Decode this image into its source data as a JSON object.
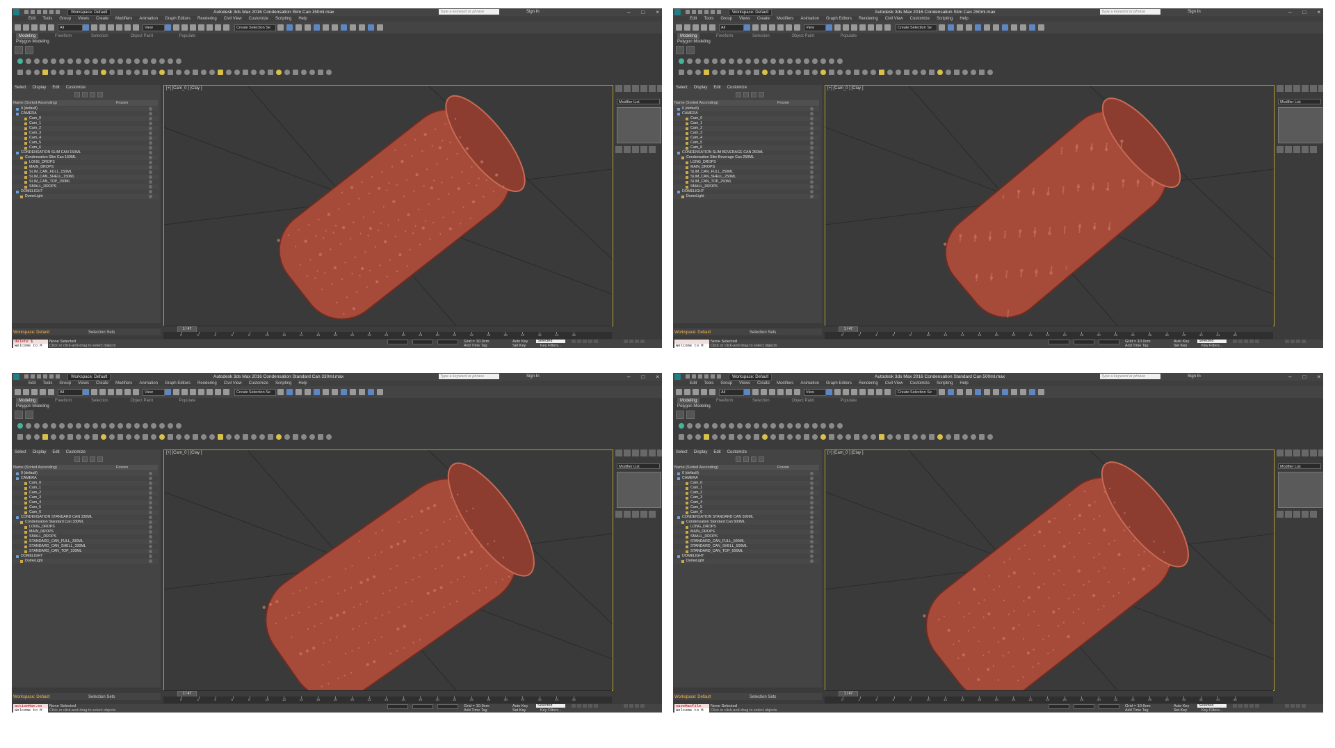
{
  "panels": [
    {
      "title": "Autodesk 3ds Max 2016     Condensation Slim Can 150ml.max",
      "workspace": "Workspace: Default",
      "search_placeholder": "Type a keyword or phrase",
      "sign_in": "Sign In",
      "menu": [
        "Edit",
        "Tools",
        "Group",
        "Views",
        "Create",
        "Modifiers",
        "Animation",
        "Graph Editors",
        "Rendering",
        "Civil View",
        "Customize",
        "Scripting",
        "Help"
      ],
      "ribbon_tabs": [
        "Modeling",
        "Freeform",
        "Selection",
        "Object Paint",
        "Populate"
      ],
      "ribbon_sub": "Polygon Modeling",
      "dropdown_all": "All",
      "dropdown_view": "View",
      "dropdown_sel": "Create Selection Se",
      "se_tabs": [
        "Select",
        "Display",
        "Edit",
        "Customize"
      ],
      "se_col_name": "Name (Sorted Ascending)",
      "se_col_frozen": "Frozen",
      "tree": [
        {
          "label": "0 (default)",
          "indent": 1
        },
        {
          "label": "CAMERA",
          "indent": 1
        },
        {
          "label": "Cam_0",
          "indent": 3
        },
        {
          "label": "Cam_1",
          "indent": 3
        },
        {
          "label": "Cam_2",
          "indent": 3
        },
        {
          "label": "Cam_3",
          "indent": 3
        },
        {
          "label": "Cam_4",
          "indent": 3
        },
        {
          "label": "Cam_5",
          "indent": 3
        },
        {
          "label": "Cam_6",
          "indent": 3
        },
        {
          "label": "CONDENSATION SLIM CAN 150ML",
          "indent": 1
        },
        {
          "label": "Condensation Slim Can 150ML",
          "indent": 2
        },
        {
          "label": "LONG_DROPS",
          "indent": 3
        },
        {
          "label": "MAIN_DROPS",
          "indent": 3
        },
        {
          "label": "SLIM_CAN_FULL_150ML",
          "indent": 3
        },
        {
          "label": "SLIM_CAN_SHELL_150ML",
          "indent": 3
        },
        {
          "label": "SLIM_CAN_TOP_150ML",
          "indent": 3
        },
        {
          "label": "SMALL_DROPS",
          "indent": 3
        },
        {
          "label": "DOMELIGHT",
          "indent": 1
        },
        {
          "label": "DomeLight",
          "indent": 2
        }
      ],
      "ws_name": "Workspace: Default",
      "selection_sets": "Selection Sets",
      "viewport_label": "[+] [Cam_0 ] [Clay ]",
      "modifier_list": "Modifier List",
      "frame": "1 / 47",
      "ticks": [
        "0",
        "2",
        "4",
        "6",
        "8",
        "10",
        "12",
        "14",
        "16",
        "18",
        "20",
        "22",
        "24",
        "26",
        "28",
        "30",
        "32",
        "34",
        "36",
        "38",
        "40",
        "42",
        "44",
        "46"
      ],
      "maxscript": "delete $",
      "welcome": "Welcome to M",
      "none_selected": "None Selected",
      "hint": "Click or click-and-drag to select objects",
      "grid": "Grid = 10.0cm",
      "add_time_tag": "Add Time Tag",
      "auto_key": "Auto Key",
      "set_key": "Set Key",
      "selected": "Selected",
      "key_filters": "Key Filters..."
    },
    {
      "title": "Autodesk 3ds Max 2016     Condensation Slim Can 250ml.max",
      "workspace": "Workspace: Default",
      "search_placeholder": "Type a keyword or phrase",
      "sign_in": "Sign In",
      "menu": [
        "Edit",
        "Tools",
        "Group",
        "Views",
        "Create",
        "Modifiers",
        "Animation",
        "Graph Editors",
        "Rendering",
        "Civil View",
        "Customize",
        "Scripting",
        "Help"
      ],
      "ribbon_tabs": [
        "Modeling",
        "Freeform",
        "Selection",
        "Object Paint",
        "Populate"
      ],
      "ribbon_sub": "Polygon Modeling",
      "dropdown_all": "All",
      "dropdown_view": "View",
      "dropdown_sel": "Create Selection Se",
      "se_tabs": [
        "Select",
        "Display",
        "Edit",
        "Customize"
      ],
      "se_col_name": "Name (Sorted Ascending)",
      "se_col_frozen": "Frozen",
      "tree": [
        {
          "label": "0 (default)",
          "indent": 1
        },
        {
          "label": "CAMERA",
          "indent": 1
        },
        {
          "label": "Cam_0",
          "indent": 3
        },
        {
          "label": "Cam_1",
          "indent": 3
        },
        {
          "label": "Cam_2",
          "indent": 3
        },
        {
          "label": "Cam_3",
          "indent": 3
        },
        {
          "label": "Cam_4",
          "indent": 3
        },
        {
          "label": "Cam_5",
          "indent": 3
        },
        {
          "label": "Cam_6",
          "indent": 3
        },
        {
          "label": "CONDENSATION SLIM BEVERAGE CAN 250ML",
          "indent": 1
        },
        {
          "label": "Condensation Slim Beverage Can 250ML",
          "indent": 2
        },
        {
          "label": "LONG_DROPS",
          "indent": 3
        },
        {
          "label": "MAIN_DROPS",
          "indent": 3
        },
        {
          "label": "SLIM_CAN_FULL_250ML",
          "indent": 3
        },
        {
          "label": "SLIM_CAN_SHELL_250ML",
          "indent": 3
        },
        {
          "label": "SLIM_CAN_TOP_250ML",
          "indent": 3
        },
        {
          "label": "SMALL_DROPS",
          "indent": 3
        },
        {
          "label": "DOMELIGHT",
          "indent": 1
        },
        {
          "label": "DomeLight",
          "indent": 2
        }
      ],
      "ws_name": "Workspace: Default",
      "selection_sets": "Selection Sets",
      "viewport_label": "[+] [Cam_0 ] [Clay ]",
      "modifier_list": "Modifier List",
      "frame": "1 / 47",
      "ticks": [
        "0",
        "2",
        "4",
        "6",
        "8",
        "10",
        "12",
        "14",
        "16",
        "18",
        "20",
        "22",
        "24",
        "26",
        "28",
        "30",
        "32",
        "34",
        "36",
        "38",
        "40",
        "42",
        "44",
        "46"
      ],
      "maxscript": "",
      "welcome": "Welcome to M",
      "none_selected": "None Selected",
      "hint": "Click or click-and-drag to select objects",
      "grid": "Grid = 10.0cm",
      "add_time_tag": "Add Time Tag",
      "auto_key": "Auto Key",
      "set_key": "Set Key",
      "selected": "Selected",
      "key_filters": "Key Filters..."
    },
    {
      "title": "Autodesk 3ds Max 2016     Condensation Standard Can 330ml.max",
      "workspace": "Workspace: Default",
      "search_placeholder": "Type a keyword or phrase",
      "sign_in": "Sign In",
      "menu": [
        "Edit",
        "Tools",
        "Group",
        "Views",
        "Create",
        "Modifiers",
        "Animation",
        "Graph Editors",
        "Rendering",
        "Civil View",
        "Customize",
        "Scripting",
        "Help"
      ],
      "ribbon_tabs": [
        "Modeling",
        "Freeform",
        "Selection",
        "Object Paint",
        "Populate"
      ],
      "ribbon_sub": "Polygon Modeling",
      "dropdown_all": "All",
      "dropdown_view": "View",
      "dropdown_sel": "Create Selection Se",
      "se_tabs": [
        "Select",
        "Display",
        "Edit",
        "Customize"
      ],
      "se_col_name": "Name (Sorted Ascending)",
      "se_col_frozen": "Frozen",
      "tree": [
        {
          "label": "0 (default)",
          "indent": 1
        },
        {
          "label": "CAMERA",
          "indent": 1
        },
        {
          "label": "Cam_0",
          "indent": 3
        },
        {
          "label": "Cam_1",
          "indent": 3
        },
        {
          "label": "Cam_2",
          "indent": 3
        },
        {
          "label": "Cam_3",
          "indent": 3
        },
        {
          "label": "Cam_4",
          "indent": 3
        },
        {
          "label": "Cam_5",
          "indent": 3
        },
        {
          "label": "Cam_6",
          "indent": 3
        },
        {
          "label": "CONDENSATION STANDARD CAN 330ML",
          "indent": 1
        },
        {
          "label": "Condensation Standard Can 330ML",
          "indent": 2
        },
        {
          "label": "LONG_DROPS",
          "indent": 3
        },
        {
          "label": "MAIN_DROPS",
          "indent": 3
        },
        {
          "label": "SMALL_DROPS",
          "indent": 3
        },
        {
          "label": "STANDARD_CAN_FULL_330ML",
          "indent": 3
        },
        {
          "label": "STANDARD_CAN_SHELL_330ML",
          "indent": 3
        },
        {
          "label": "STANDARD_CAN_TOP_330ML",
          "indent": 3
        },
        {
          "label": "DOMELIGHT",
          "indent": 1
        },
        {
          "label": "DomeLight",
          "indent": 2
        }
      ],
      "ws_name": "Workspace: Default",
      "selection_sets": "Selection Sets",
      "viewport_label": "[+] [Cam_0 ] [Clay ]",
      "modifier_list": "Modifier List",
      "frame": "1 / 47",
      "ticks": [
        "0",
        "2",
        "4",
        "6",
        "8",
        "10",
        "12",
        "14",
        "16",
        "18",
        "20",
        "22",
        "24",
        "26",
        "28",
        "30",
        "32",
        "34",
        "36",
        "38",
        "40",
        "42",
        "44",
        "46"
      ],
      "maxscript": "actionMan.ex",
      "welcome": "Welcome to M",
      "none_selected": "None Selected",
      "hint": "Click or click-and-drag to select objects",
      "grid": "Grid = 10.0cm",
      "add_time_tag": "Add Time Tag",
      "auto_key": "Auto Key",
      "set_key": "Set Key",
      "selected": "Selected",
      "key_filters": "Key Filters..."
    },
    {
      "title": "Autodesk 3ds Max 2016     Condensation Standard Can 500ml.max",
      "workspace": "Workspace: Default",
      "search_placeholder": "Type a keyword or phrase",
      "sign_in": "Sign In",
      "menu": [
        "Edit",
        "Tools",
        "Group",
        "Views",
        "Create",
        "Modifiers",
        "Animation",
        "Graph Editors",
        "Rendering",
        "Civil View",
        "Customize",
        "Scripting",
        "Help"
      ],
      "ribbon_tabs": [
        "Modeling",
        "Freeform",
        "Selection",
        "Object Paint",
        "Populate"
      ],
      "ribbon_sub": "Polygon Modeling",
      "dropdown_all": "All",
      "dropdown_view": "View",
      "dropdown_sel": "Create Selection Se",
      "se_tabs": [
        "Select",
        "Display",
        "Edit",
        "Customize"
      ],
      "se_col_name": "Name (Sorted Ascending)",
      "se_col_frozen": "Frozen",
      "tree": [
        {
          "label": "0 (default)",
          "indent": 1
        },
        {
          "label": "CAMERA",
          "indent": 1
        },
        {
          "label": "Cam_0",
          "indent": 3
        },
        {
          "label": "Cam_1",
          "indent": 3
        },
        {
          "label": "Cam_2",
          "indent": 3
        },
        {
          "label": "Cam_3",
          "indent": 3
        },
        {
          "label": "Cam_4",
          "indent": 3
        },
        {
          "label": "Cam_5",
          "indent": 3
        },
        {
          "label": "Cam_6",
          "indent": 3
        },
        {
          "label": "CONDENSATION STANDARD CAN 500ML",
          "indent": 1
        },
        {
          "label": "Condensation Standard Can 500ML",
          "indent": 2
        },
        {
          "label": "LONG_DROPS",
          "indent": 3
        },
        {
          "label": "MAIN_DROPS",
          "indent": 3
        },
        {
          "label": "SMALL_DROPS",
          "indent": 3
        },
        {
          "label": "STANDARD_CAN_FULL_500ML",
          "indent": 3
        },
        {
          "label": "STANDARD_CAN_SHELL_500ML",
          "indent": 3
        },
        {
          "label": "STANDARD_CAN_TOP_500ML",
          "indent": 3
        },
        {
          "label": "DOMELIGHT",
          "indent": 1
        },
        {
          "label": "DomeLight",
          "indent": 2
        }
      ],
      "ws_name": "Workspace: Default",
      "selection_sets": "Selection Sets",
      "viewport_label": "[+] [Cam_0 ] [Clay ]",
      "modifier_list": "Modifier List",
      "frame": "1 / 47",
      "ticks": [
        "0",
        "2",
        "4",
        "6",
        "8",
        "10",
        "12",
        "14",
        "16",
        "18",
        "20",
        "22",
        "24",
        "26",
        "28",
        "30",
        "32",
        "34",
        "36",
        "38",
        "40",
        "42",
        "44",
        "46"
      ],
      "maxscript": "saveMaxFile",
      "welcome": "Welcome to M",
      "none_selected": "None Selected",
      "hint": "Click or click-and-drag to select objects",
      "grid": "Grid = 10.0cm",
      "add_time_tag": "Add Time Tag",
      "auto_key": "Auto Key",
      "set_key": "Set Key",
      "selected": "Selected",
      "key_filters": "Key Filters..."
    }
  ],
  "colors": {
    "can": "#a64a3a",
    "can_shadow": "#6e2c22",
    "viewport_border": "#b8a234",
    "workspace_text": "#ffb84d"
  }
}
